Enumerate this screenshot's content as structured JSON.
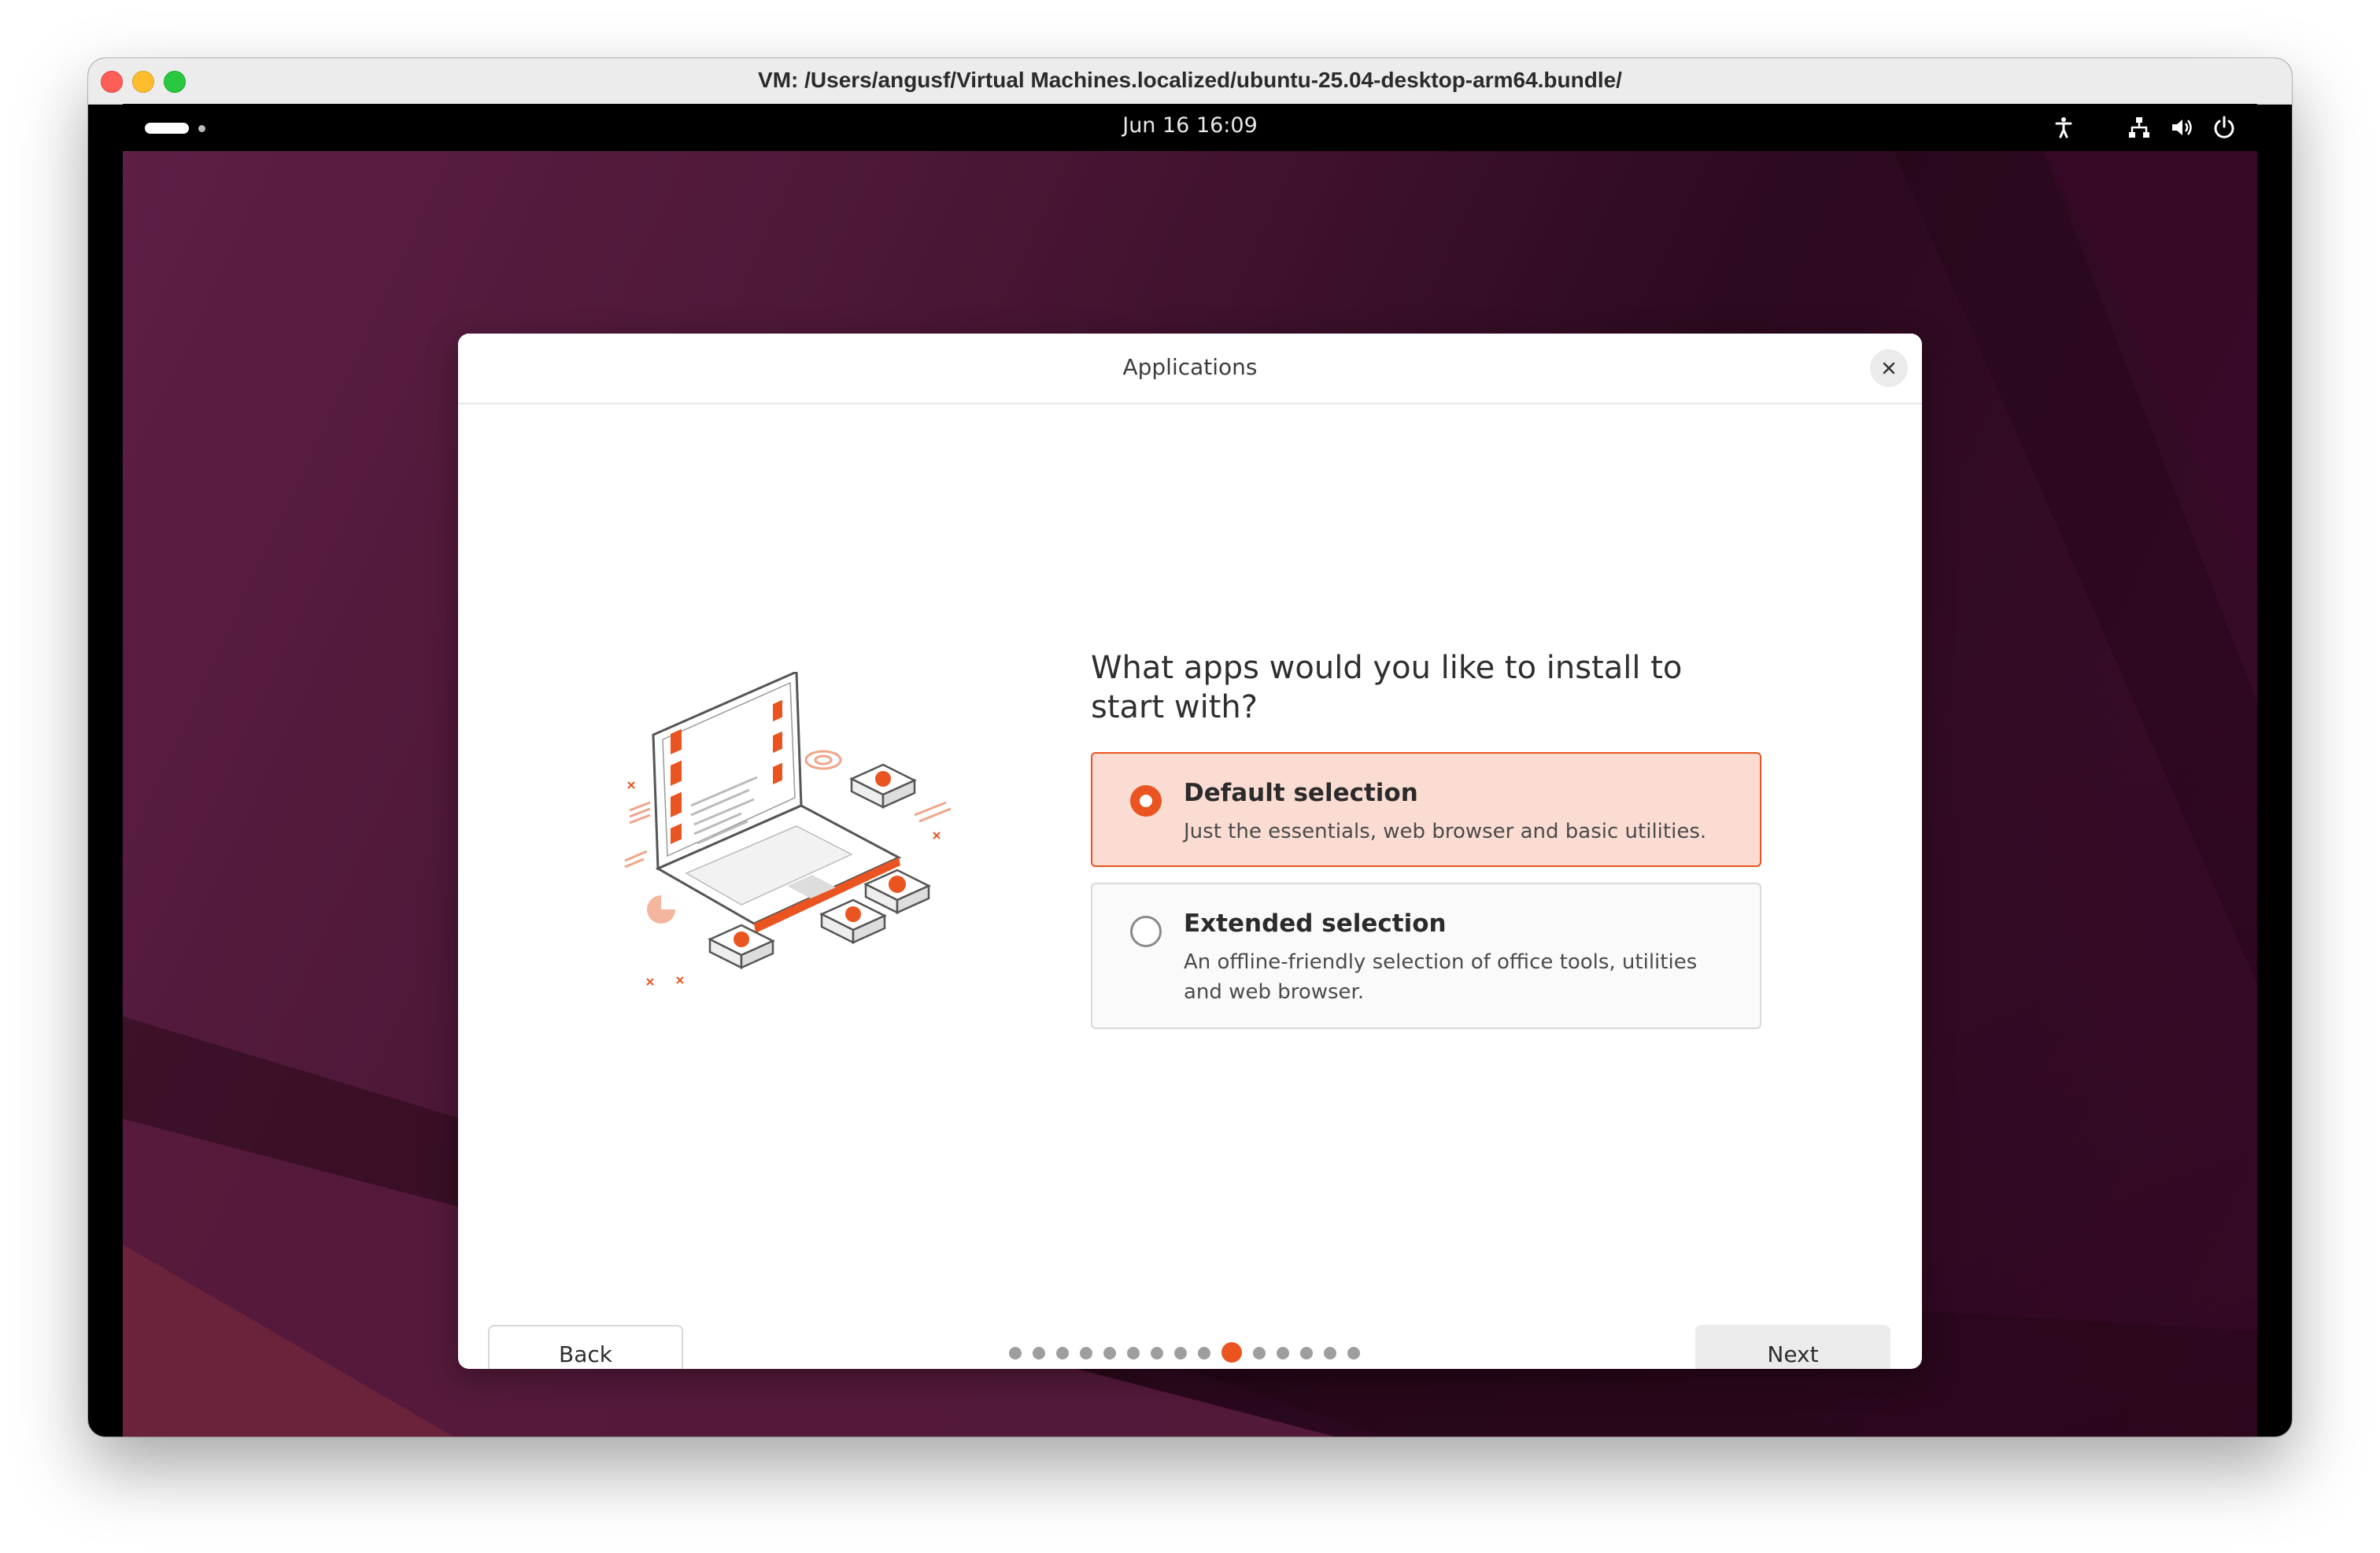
{
  "window": {
    "title": "VM: /Users/angusf/Virtual Machines.localized/ubuntu-25.04-desktop-arm64.bundle/"
  },
  "topbar": {
    "clock": "Jun 16  16:09",
    "icons": [
      "accessibility-icon",
      "network-icon",
      "volume-icon",
      "power-icon"
    ]
  },
  "dialog": {
    "title": "Applications",
    "question": "What apps would you like to install to start with?",
    "options": [
      {
        "title": "Default selection",
        "description": "Just the essentials, web browser and basic utilities.",
        "selected": true
      },
      {
        "title": "Extended selection",
        "description": "An offline-friendly selection of office tools, utilities and web browser.",
        "selected": false
      }
    ],
    "back_label": "Back",
    "next_label": "Next",
    "pager": {
      "total": 15,
      "current": 10
    }
  },
  "colors": {
    "accent": "#e95420",
    "selected_background": "#fbdcd3",
    "desktop_primary": "#5e1f45",
    "desktop_dark": "#2c0a1f"
  }
}
